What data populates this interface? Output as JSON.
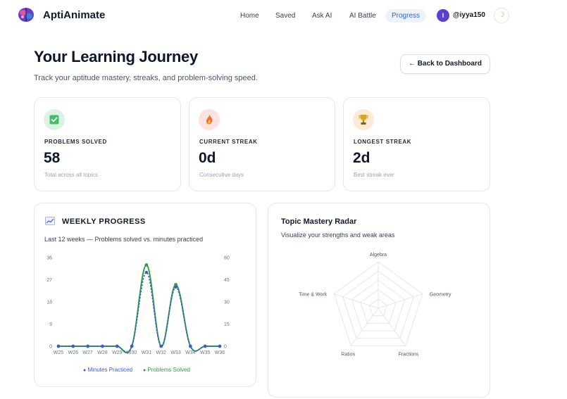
{
  "nav": {
    "brand": "AptiAnimate",
    "links": [
      "Home",
      "Saved",
      "Ask AI",
      "AI Battle"
    ],
    "active": "Progress",
    "avatar_initial": "I",
    "username": "@iyya150",
    "theme_icon": "☽"
  },
  "header": {
    "title": "Your Learning Journey",
    "subtitle": "Track your aptitude mastery, streaks, and problem-solving speed.",
    "back_label": "← Back to Dashboard"
  },
  "stats": [
    {
      "label": "PROBLEMS SOLVED",
      "value": "58",
      "desc": "Total across all topics",
      "icon": "check-icon"
    },
    {
      "label": "CURRENT STREAK",
      "value": "0d",
      "desc": "Consecutive days",
      "icon": "fire-icon"
    },
    {
      "label": "LONGEST STREAK",
      "value": "2d",
      "desc": "Best streak ever",
      "icon": "trophy-icon"
    }
  ],
  "weekly": {
    "title": "WEEKLY PROGRESS",
    "subtitle": "Last 12 weeks — Problems solved vs. minutes practiced",
    "legend": [
      "Minutes Practiced",
      "Problems Solved"
    ]
  },
  "radar": {
    "title": "Topic Mastery Radar",
    "subtitle": "Visualize your strengths and weak areas"
  },
  "colors": {
    "minutes": "#3b5bdb",
    "problems": "#2f9e44",
    "accent": "#2f5fd0"
  },
  "chart_data": [
    {
      "type": "line",
      "x": [
        "W25",
        "W26",
        "W27",
        "W28",
        "W29",
        "W30",
        "W31",
        "W32",
        "W33",
        "W34",
        "W35",
        "W36"
      ],
      "series": [
        {
          "name": "Minutes Practiced",
          "axis": "right",
          "values": [
            0,
            0,
            0,
            0,
            0,
            0,
            50,
            0,
            40,
            0,
            0,
            0
          ]
        },
        {
          "name": "Problems Solved",
          "axis": "left",
          "values": [
            0,
            0,
            0,
            0,
            0,
            0,
            33,
            0,
            25,
            0,
            0,
            0
          ]
        }
      ],
      "y_left": {
        "ticks": [
          0,
          9,
          18,
          27,
          36
        ],
        "range": [
          0,
          36
        ]
      },
      "y_right": {
        "ticks": [
          0,
          15,
          30,
          45,
          60
        ],
        "range": [
          0,
          60
        ]
      },
      "grid": false,
      "legend_position": "bottom"
    },
    {
      "type": "radar",
      "axes": [
        "Algebra",
        "Geometry",
        "Fractions",
        "Ratios",
        "Time & Work"
      ],
      "values": [
        0,
        0,
        0,
        0,
        0
      ],
      "levels": 5
    }
  ]
}
